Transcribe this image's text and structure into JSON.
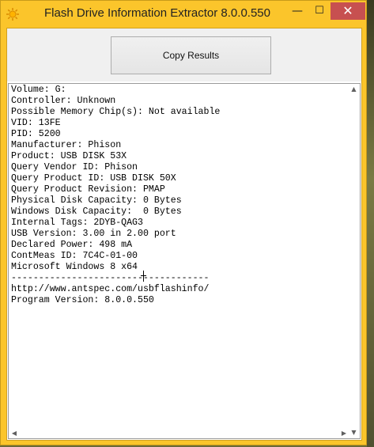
{
  "window": {
    "title": "Flash Drive Information Extractor 8.0.0.550",
    "colors": {
      "frame": "#fbc52b",
      "close_button": "#c75050"
    },
    "icons": {
      "app": "sun-icon",
      "minimize": "minimize-icon",
      "maximize": "maximize-icon",
      "close": "close-icon"
    },
    "minimize_glyph": "—",
    "maximize_glyph": "☐",
    "close_glyph": "✕"
  },
  "toolbar": {
    "copy_label": "Copy Results"
  },
  "output": {
    "lines": [
      "Volume: G:",
      "Controller: Unknown",
      "Possible Memory Chip(s): Not available",
      "VID: 13FE",
      "PID: 5200",
      "Manufacturer: Phison",
      "Product: USB DISK 53X",
      "Query Vendor ID: Phison",
      "Query Product ID: USB DISK 50X",
      "Query Product Revision: PMAP",
      "Physical Disk Capacity: 0 Bytes",
      "Windows Disk Capacity:  0 Bytes",
      "Internal Tags: 2DYB-QAG3",
      "USB Version: 3.00 in 2.00 port",
      "Declared Power: 498 mA",
      "ContMeas ID: 7C4C-01-00",
      "Microsoft Windows 8 x64",
      "------------------------------------",
      "http://www.antspec.com/usbflashinfo/",
      "Program Version: 8.0.0.550"
    ]
  },
  "scrollbar": {
    "up_glyph": "▲",
    "down_glyph": "▼",
    "left_glyph": "◀",
    "right_glyph": "▶"
  }
}
